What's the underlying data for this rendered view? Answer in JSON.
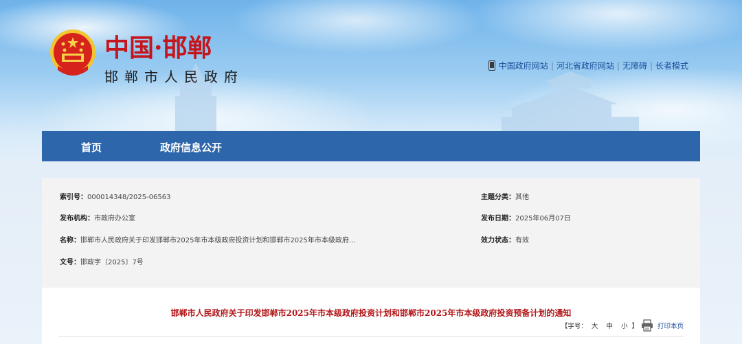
{
  "header": {
    "logo_title": "中国·邯郸",
    "site_name": "邯郸市人民政府",
    "links": [
      "中国政府网站",
      "河北省政府网站",
      "无障碍",
      "长者模式"
    ],
    "separator": "|"
  },
  "nav": {
    "items": [
      "首页",
      "政府信息公开"
    ]
  },
  "info": {
    "index_label": "索引号：",
    "index_value": "000014348/2025-06563",
    "category_label": "主题分类：",
    "category_value": "其他",
    "publisher_label": "发布机构：",
    "publisher_value": "市政府办公室",
    "date_label": "发布日期：",
    "date_value": "2025年06月07日",
    "name_label": "名称：",
    "name_value": "邯郸市人民政府关于印发邯郸市2025年市本级政府投资计划和邯郸市2025年市本级政府...",
    "status_label": "效力状态：",
    "status_value": "有效",
    "docno_label": "文号：",
    "docno_value": "邯政字〔2025〕7号"
  },
  "content": {
    "title": "邯郸市人民政府关于印发邯郸市2025年市本级政府投资计划和邯郸市2025年市本级政府投资预备计划的通知",
    "font_label": "【字号：",
    "sizes": [
      "大",
      "中",
      "小"
    ],
    "font_close": "】",
    "print_label": "打印本页"
  },
  "colors": {
    "nav_bg": "#2d66ab",
    "title_red": "#b2171a",
    "link_blue": "#1c4f9b"
  },
  "icons": [
    "emblem-icon",
    "phone-icon",
    "print-icon"
  ]
}
